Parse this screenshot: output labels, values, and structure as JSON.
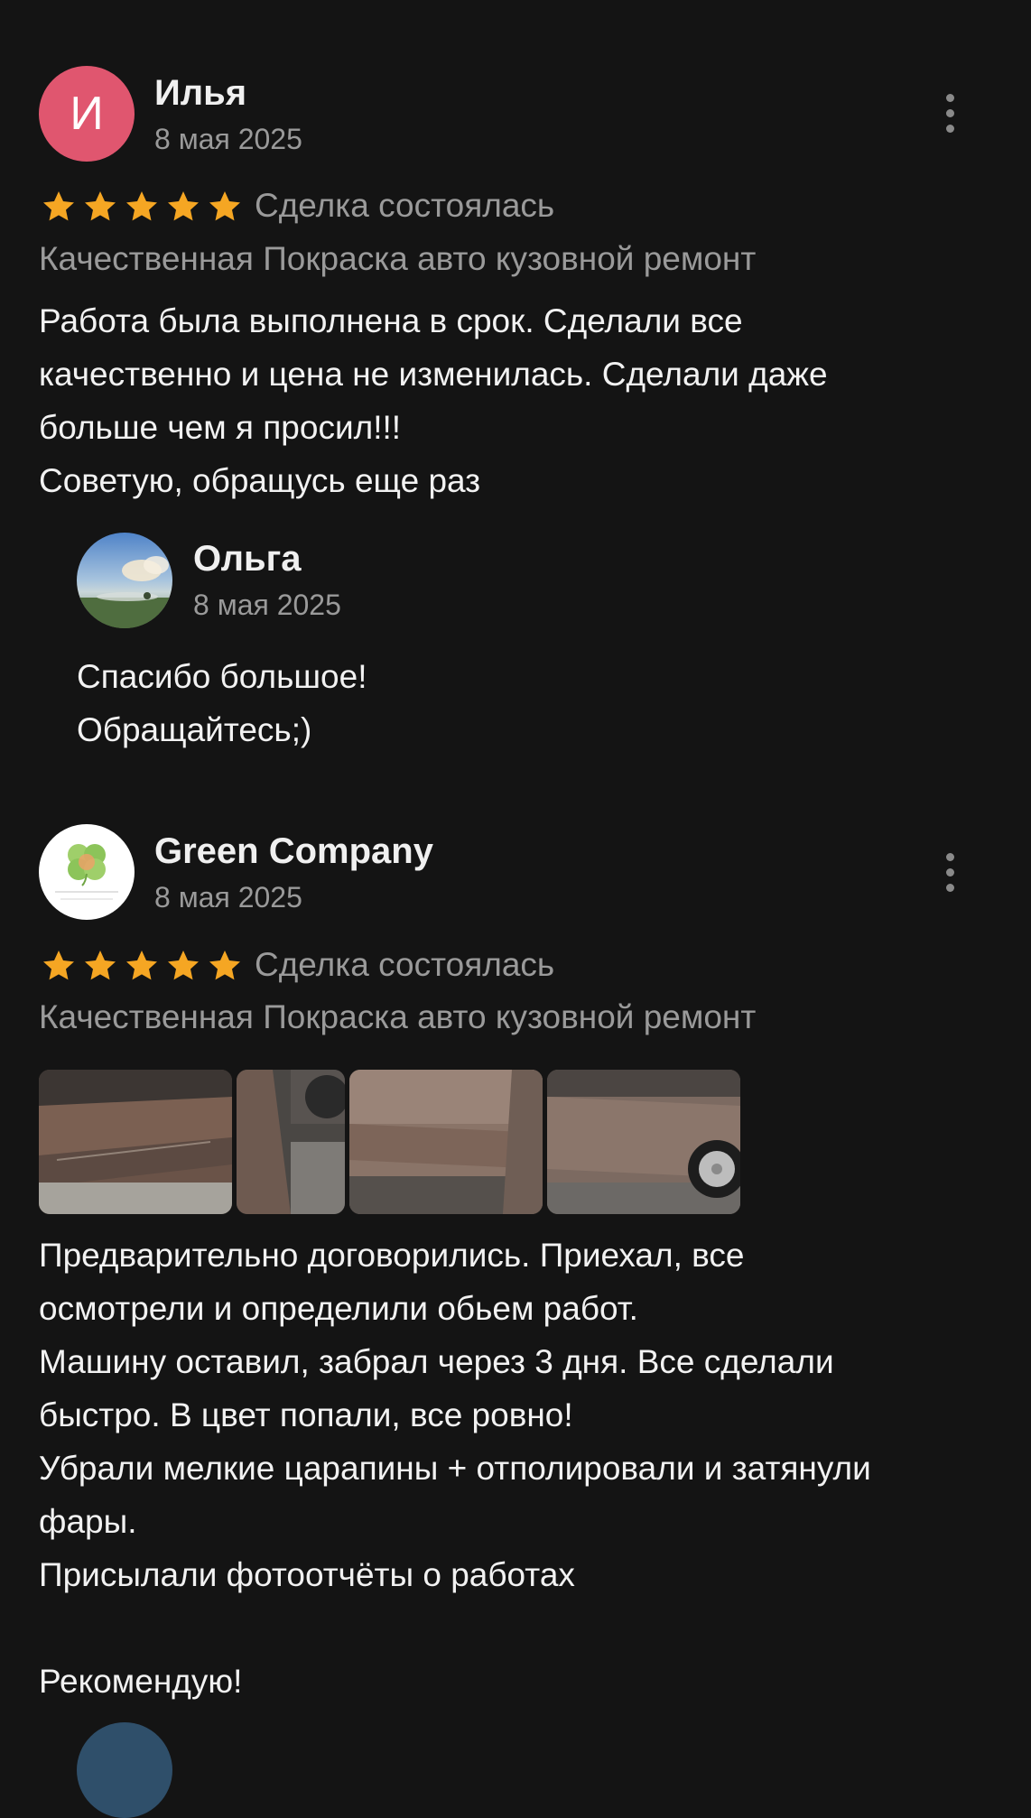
{
  "reviews": [
    {
      "avatar_letter": "И",
      "author": "Илья",
      "date": "8 мая 2025",
      "rating": 5,
      "deal_status": "Сделка состоялась",
      "service": "Качественная Покраска авто кузовной ремонт",
      "text_lines": [
        "Работа была выполнена в срок. Сделали все",
        "качественно и цена не изменилась. Сделали даже",
        "больше чем я просил!!!",
        "Советую, обращусь еще раз"
      ],
      "reply": {
        "author": "Ольга",
        "date": "8 мая 2025",
        "text_lines": [
          "Спасибо большое!",
          "Обращайтесь;)"
        ]
      }
    },
    {
      "author": "Green Company",
      "avatar_logo_text": "GREEN MARKET",
      "date": "8 мая 2025",
      "rating": 5,
      "deal_status": "Сделка состоялась",
      "service": "Качественная Покраска авто кузовной ремонт",
      "photos": [
        "car-door-sill-photo",
        "car-rear-wheel-photo",
        "car-side-panel-photo",
        "car-rear-fender-photo"
      ],
      "text_lines": [
        "Предварительно договорились. Приехал, все",
        "осмотрели и определили обьем работ.",
        "Машину оставил, забрал через 3 дня. Все сделали",
        "быстро. В цвет попали, все ровно!",
        "Убрали мелкие царапины + отполировали и затянули",
        "фары.",
        "Присылали фотоотчёты о работах",
        "",
        "Рекомендую!"
      ]
    }
  ],
  "colors": {
    "background": "#141414",
    "star": "#f5a623",
    "avatar_pink": "#e0566f",
    "secondary_text": "#9a9a9a"
  }
}
